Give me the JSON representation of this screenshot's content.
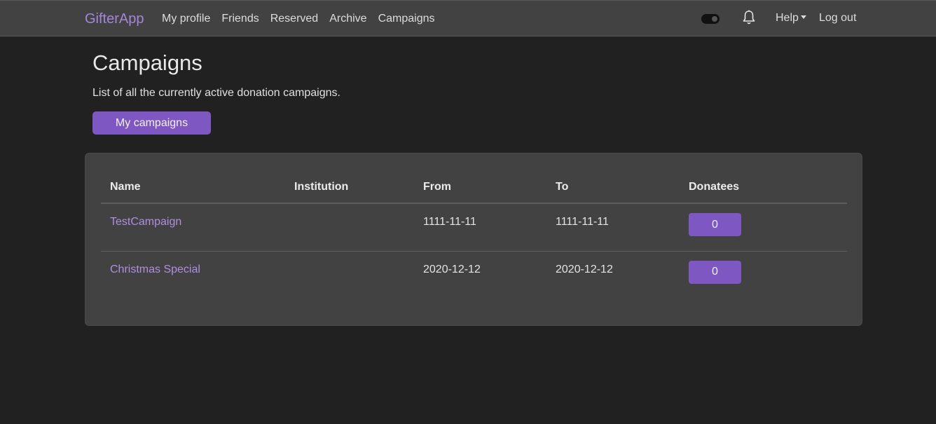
{
  "nav": {
    "brand": "GifterApp",
    "links": [
      "My profile",
      "Friends",
      "Reserved",
      "Archive",
      "Campaigns"
    ],
    "help": "Help",
    "logout": "Log out",
    "icons": [
      "toggle-switch-icon",
      "bell-icon",
      "caret-down-icon"
    ]
  },
  "page": {
    "title": "Campaigns",
    "subtitle": "List of all the currently active donation campaigns.",
    "my_campaigns_button": "My campaigns"
  },
  "table": {
    "headers": [
      "Name",
      "Institution",
      "From",
      "To",
      "Donatees"
    ],
    "rows": [
      {
        "name": "TestCampaign",
        "institution": "",
        "from": "1111-11-11",
        "to": "1111-11-11",
        "donatees": "0"
      },
      {
        "name": "Christmas Special",
        "institution": "",
        "from": "2020-12-12",
        "to": "2020-12-12",
        "donatees": "0"
      }
    ]
  },
  "colors": {
    "accent": "#7e57c2",
    "link": "#b08ee0",
    "background": "#212121",
    "surface": "#424242"
  }
}
